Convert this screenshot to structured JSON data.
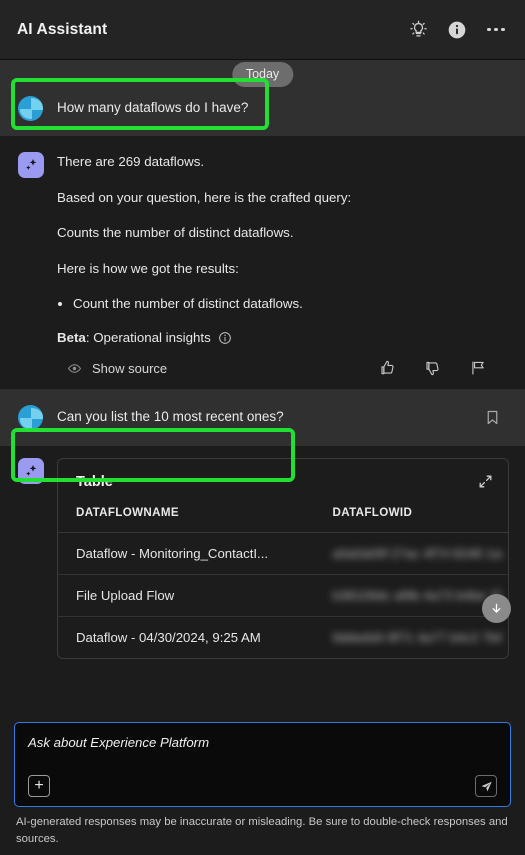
{
  "header": {
    "title": "AI Assistant",
    "icons": [
      {
        "name": "lightbulb-icon",
        "label": "Ideas"
      },
      {
        "name": "info-icon",
        "label": "Information"
      },
      {
        "name": "more-options-icon",
        "label": "More options"
      }
    ]
  },
  "conversation": {
    "date_divider": "Today",
    "messages": [
      {
        "role": "user",
        "text": "How many dataflows do I have?"
      },
      {
        "role": "assistant",
        "lines": [
          "There are 269 dataflows.",
          "Based on your question, here is the crafted query:",
          "Counts the number of distinct dataflows.",
          "Here is how we got the results:"
        ],
        "bullets": [
          "Count the number of distinct dataflows."
        ],
        "beta_label": "Beta",
        "beta_text": ": Operational insights",
        "show_source_label": "Show source",
        "feedback": {
          "thumbs_up": "Good response",
          "thumbs_down": "Bad response",
          "flag": "Report"
        }
      },
      {
        "role": "user",
        "text": "Can you list the 10 most recent ones?",
        "bookmark_label": "Save"
      },
      {
        "role": "assistant",
        "card": {
          "title": "Table",
          "expand_label": "Expand",
          "columns": [
            "DATAFLOWNAME",
            "DATAFLOWID"
          ],
          "rows": [
            {
              "name": "Dataflow - Monitoring_ContactI...",
              "id": ""
            },
            {
              "name": "File Upload Flow",
              "id": ""
            },
            {
              "name": "Dataflow - 04/30/2024, 9:25 AM",
              "id": ""
            }
          ],
          "scroll_down_label": "Scroll down"
        }
      }
    ]
  },
  "composer": {
    "placeholder": "Ask about Experience Platform",
    "attach_label": "+",
    "send_label": "Send",
    "disclaimer": "AI-generated responses may be inaccurate or misleading. Be sure to double-check responses and sources."
  },
  "colors": {
    "accent_blue": "#2f7ae5",
    "highlight_green": "#22e033",
    "assistant_avatar": "#9a9af0",
    "user_avatar": "#2a9fd6",
    "background": "#1c1c1c",
    "user_row_background": "#303030"
  }
}
